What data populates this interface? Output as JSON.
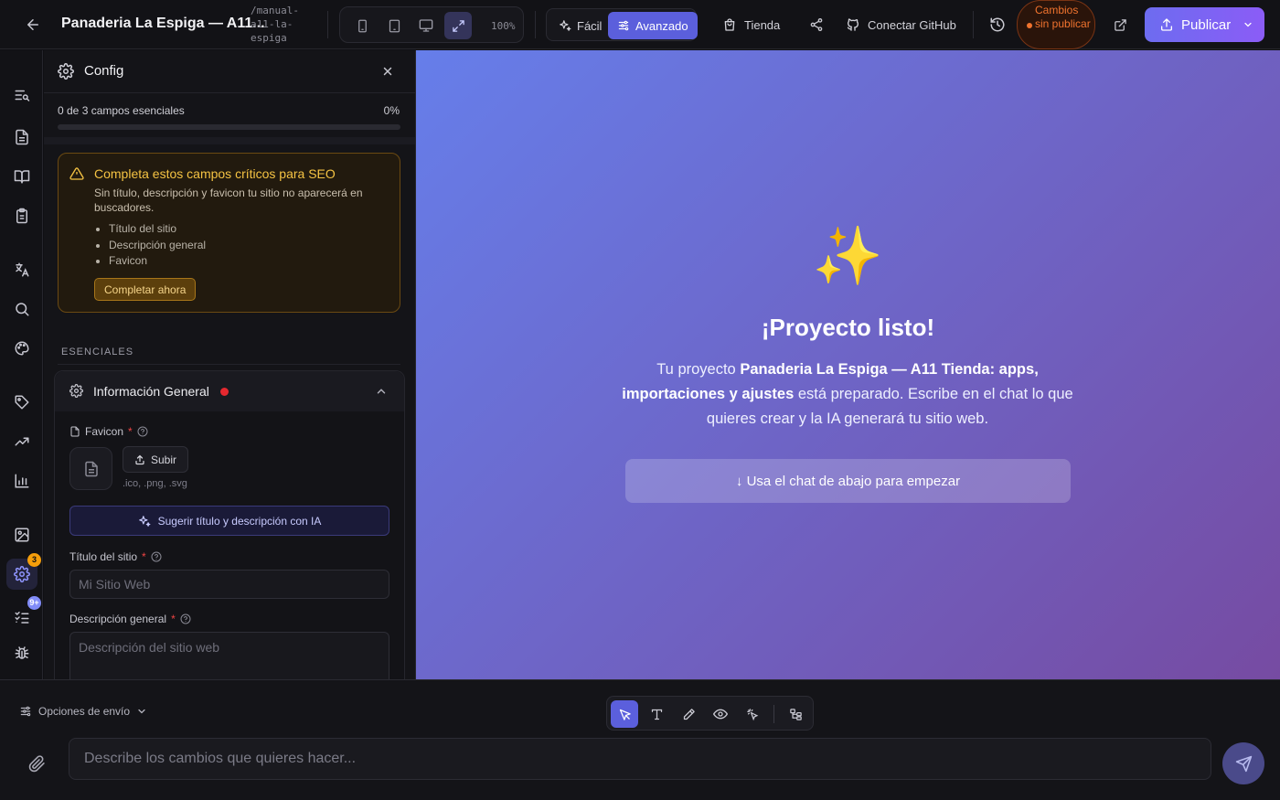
{
  "topbar": {
    "project_title": "Panaderia La Espiga — A11...",
    "project_slug": "/manual-a11-la-espiga",
    "zoom": "100%",
    "modes": [
      {
        "label": "Fácil"
      },
      {
        "label": "Avanzado"
      }
    ],
    "links": {
      "store": "Tienda",
      "github": "Conectar GitHub"
    },
    "unsaved": "Cambios sin publicar",
    "publish": "Publicar"
  },
  "rail": {
    "settings_badge": "3",
    "tasks_badge": "9+"
  },
  "config": {
    "title": "Config",
    "progress_text": "0 de 3 campos esenciales",
    "progress_pct": "0%",
    "progress_value": 0,
    "warning": {
      "title": "Completa estos campos críticos para SEO",
      "desc": "Sin título, descripción y favicon tu sitio no aparecerá en buscadores.",
      "items": [
        "Título del sitio",
        "Descripción general",
        "Favicon"
      ],
      "button": "Completar ahora"
    },
    "section_label": "ESENCIALES",
    "accordion_title": "Información General",
    "favicon_label": "Favicon",
    "required_mark": "*",
    "upload_label": "Subir",
    "favicon_hint": ".ico, .png, .svg",
    "ai_button": "Sugerir título y descripción con IA",
    "site_title_label": "Título del sitio",
    "site_title_placeholder": "Mi Sitio Web",
    "desc_label": "Descripción general",
    "desc_placeholder": "Descripción del sitio web"
  },
  "preview": {
    "emoji": "✨",
    "title": "¡Proyecto listo!",
    "desc_prefix": "Tu proyecto ",
    "desc_bold": "Panaderia La Espiga — A11 Tienda: apps, importaciones y ajustes",
    "desc_suffix": " está preparado. Escribe en el chat lo que quieres crear y la IA generará tu sitio web.",
    "cta": "↓ Usa el chat de abajo para empezar"
  },
  "chat": {
    "send_options": "Opciones de envío",
    "placeholder": "Describe los cambios que quieres hacer..."
  },
  "colors": {
    "accent": "#5b5fdc",
    "warning": "#f5c343",
    "unsaved": "#f0732e",
    "error_dot": "#e5282f",
    "preview_start": "#667eea",
    "preview_end": "#764ba2"
  }
}
